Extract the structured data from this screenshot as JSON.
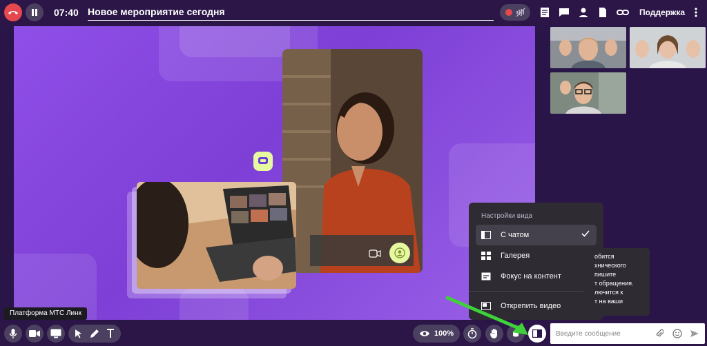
{
  "header": {
    "timer": "07:40",
    "title": "Новое мероприятие сегодня",
    "support_label": "Поддержка"
  },
  "view_menu": {
    "title": "Настройки вида",
    "items": [
      {
        "label": "С чатом",
        "icon": "split-view-icon",
        "selected": true
      },
      {
        "label": "Галерея",
        "icon": "gallery-icon",
        "selected": false
      },
      {
        "label": "Фокус на контент",
        "icon": "focus-content-icon",
        "selected": false
      },
      {
        "label": "Открепить видео",
        "icon": "detach-video-icon",
        "selected": false
      }
    ]
  },
  "chat_notice": {
    "lines": [
      "обится",
      "хнического",
      "пишите",
      "т обращения.",
      "лючится к",
      "т на ваши"
    ]
  },
  "tooltip": {
    "text": "Платформа МТС Линк"
  },
  "toolbar": {
    "zoom_value": "100%"
  },
  "chat": {
    "placeholder": "Введите сообщение"
  },
  "colors": {
    "accent_red": "#e5484d",
    "stage_purple": "#8f4fe8",
    "highlight_arrow": "#3fd13a",
    "lime": "#e6f9a0"
  }
}
